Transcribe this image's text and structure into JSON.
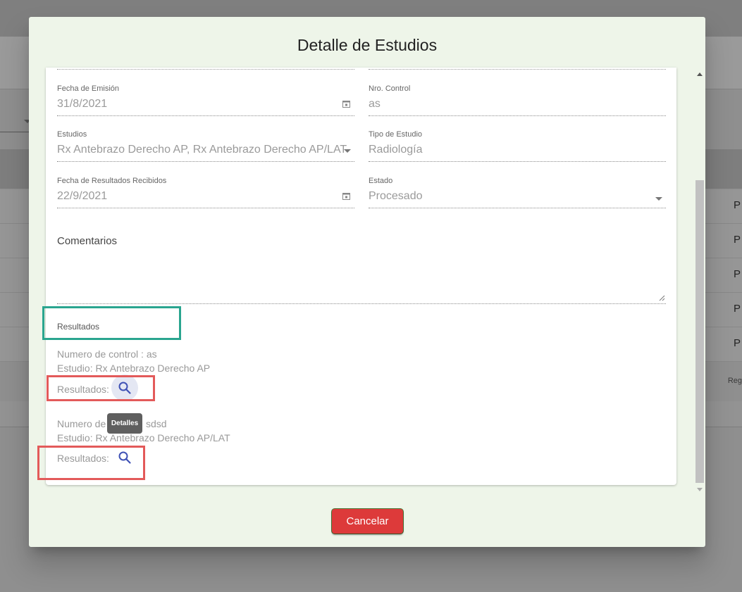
{
  "dialog": {
    "title": "Detalle de Estudios"
  },
  "form": {
    "fecha_emision": {
      "label": "Fecha de Emisión",
      "value": "31/8/2021"
    },
    "nro_control": {
      "label": "Nro. Control",
      "value": "as"
    },
    "estudios": {
      "label": "Estudios",
      "value": "Rx Antebrazo Derecho AP, Rx Antebrazo Derecho AP/LAT"
    },
    "tipo_estudio": {
      "label": "Tipo de Estudio",
      "value": "Radiología"
    },
    "fecha_resultados": {
      "label": "Fecha de Resultados Recibidos",
      "value": "22/9/2021"
    },
    "estado": {
      "label": "Estado",
      "value": "Procesado"
    },
    "comentarios": {
      "label": "Comentarios",
      "value": ""
    }
  },
  "results": {
    "heading": "Resultados",
    "items": [
      {
        "control_line": "Numero de control : as",
        "study_line": "Estudio: Rx Antebrazo Derecho AP",
        "results_label": "Resultados:"
      },
      {
        "control_line_prefix": "Numero de",
        "control_line_suffix": "sdsd",
        "study_line": "Estudio: Rx Antebrazo Derecho AP/LAT",
        "results_label": "Resultados:"
      }
    ],
    "tooltip": "Detalles"
  },
  "actions": {
    "cancel_label": "Cancelar"
  },
  "background": {
    "row_cell": "P",
    "footer_text": "Reg"
  },
  "colors": {
    "cancel": "#dd3a3a",
    "dialog_bg": "#eef5e9",
    "icon": "#3f51b5",
    "annotation_red": "#e35a5a",
    "annotation_teal": "#2aa58f"
  }
}
